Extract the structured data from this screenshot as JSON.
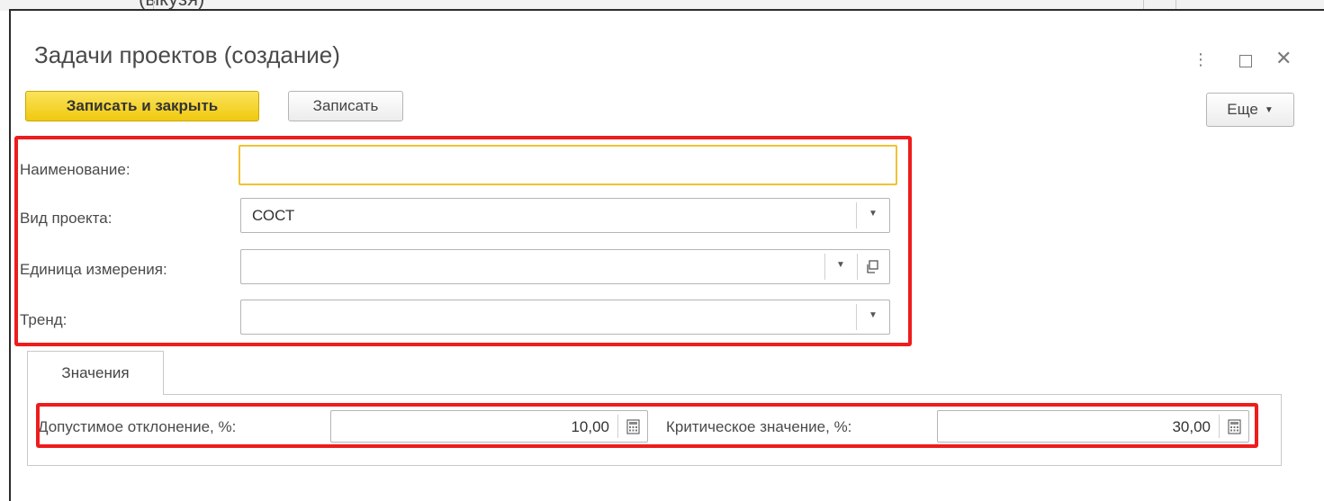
{
  "background": {
    "title_fragment": "(ыкузя)"
  },
  "window": {
    "title": "Задачи проектов (создание)",
    "controls": {
      "more": "⋮",
      "close": "✕"
    }
  },
  "toolbar": {
    "save_close_label": "Записать и закрыть",
    "save_label": "Записать",
    "more_label": "Еще"
  },
  "form": {
    "name": {
      "label": "Наименование:",
      "value": ""
    },
    "project_type": {
      "label": "Вид проекта:",
      "value": "СОСТ"
    },
    "unit": {
      "label": "Единица измерения:",
      "value": ""
    },
    "trend": {
      "label": "Тренд:",
      "value": ""
    }
  },
  "tabs": {
    "values_label": "Значения"
  },
  "values": {
    "deviation": {
      "label": "Допустимое отклонение, %:",
      "value": "10,00"
    },
    "critical": {
      "label": "Критическое значение, %:",
      "value": "30,00"
    }
  },
  "colors": {
    "accent": "#f0c90f",
    "highlight": "#ee1c1c",
    "focus": "#f1c232"
  },
  "icons": [
    "more-vertical-icon",
    "maximize-icon",
    "close-icon",
    "dropdown-icon",
    "open-icon",
    "calculator-icon"
  ]
}
